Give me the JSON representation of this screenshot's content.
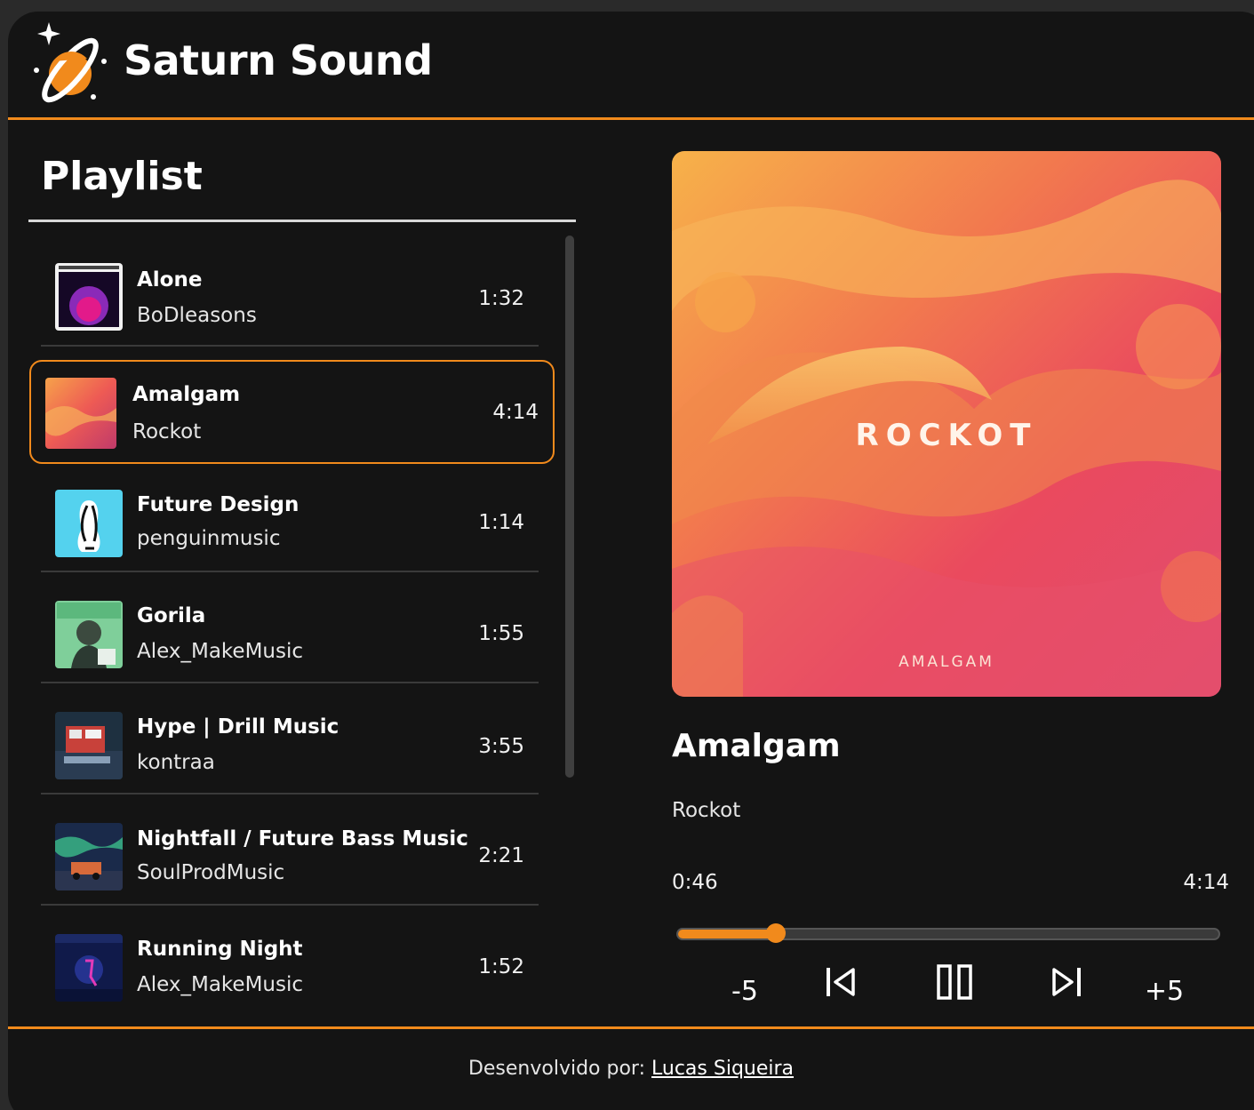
{
  "app": {
    "title": "Saturn Sound",
    "accent_color": "#f18a1c",
    "background_color": "#141414"
  },
  "playlist": {
    "heading": "Playlist",
    "tracks": [
      {
        "title": "Alone",
        "artist": "BoDleasons",
        "duration": "1:32",
        "active": false,
        "thumb_icon": "alone-cover"
      },
      {
        "title": "Amalgam",
        "artist": "Rockot",
        "duration": "4:14",
        "active": true,
        "thumb_icon": "amalgam-cover"
      },
      {
        "title": "Future Design",
        "artist": "penguinmusic",
        "duration": "1:14",
        "active": false,
        "thumb_icon": "penguin-cover"
      },
      {
        "title": "Gorila",
        "artist": "Alex_MakeMusic",
        "duration": "1:55",
        "active": false,
        "thumb_icon": "gorila-cover"
      },
      {
        "title": "Hype | Drill Music",
        "artist": "kontraa",
        "duration": "3:55",
        "active": false,
        "thumb_icon": "hype-cover"
      },
      {
        "title": "Nightfall / Future Bass Music",
        "artist": "SoulProdMusic",
        "duration": "2:21",
        "active": false,
        "thumb_icon": "nightfall-cover"
      },
      {
        "title": "Running Night",
        "artist": "Alex_MakeMusic",
        "duration": "1:52",
        "active": false,
        "thumb_icon": "running-night-cover"
      }
    ]
  },
  "player": {
    "title": "Amalgam",
    "artist": "Rockot",
    "cover_band_text": "ROCKOT",
    "cover_album_text": "AMALGAM",
    "current_time": "0:46",
    "total_time": "4:14",
    "progress_fraction": 0.181,
    "controls": {
      "back5_label": "-5",
      "forward5_label": "+5",
      "prev_icon": "skip-previous-icon",
      "pause_icon": "pause-icon",
      "next_icon": "skip-next-icon"
    }
  },
  "footer": {
    "prefix": "Desenvolvido por:",
    "author_link": "Lucas Siqueira"
  }
}
